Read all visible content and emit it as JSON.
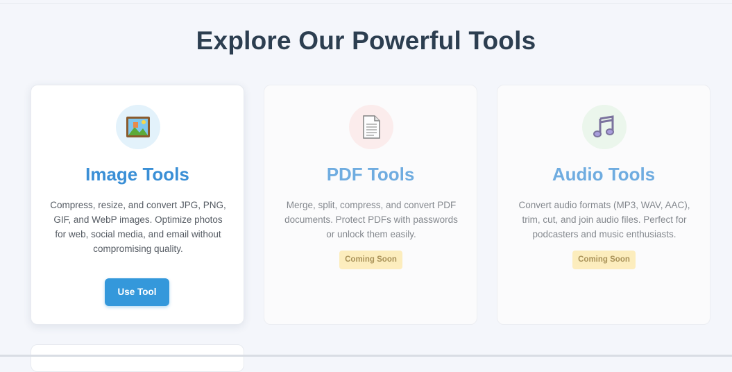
{
  "section": {
    "title": "Explore Our Powerful Tools"
  },
  "cards": [
    {
      "title": "Image Tools",
      "description": "Compress, resize, and convert JPG, PNG, GIF, and WebP images. Optimize photos for web, social media, and email without compromising quality.",
      "icon": "framed-picture-icon",
      "action_label": "Use Tool"
    },
    {
      "title": "PDF Tools",
      "description": "Merge, split, compress, and convert PDF documents. Protect PDFs with passwords or unlock them easily.",
      "icon": "document-icon",
      "badge": "Coming Soon"
    },
    {
      "title": "Audio Tools",
      "description": "Convert audio formats (MP3, WAV, AAC), trim, cut, and join audio files. Perfect for podcasters and music enthusiasts.",
      "icon": "music-notes-icon",
      "badge": "Coming Soon"
    }
  ],
  "colors": {
    "accent": "#3498db",
    "title": "#2c3e50",
    "badge": "#fde8a6"
  }
}
